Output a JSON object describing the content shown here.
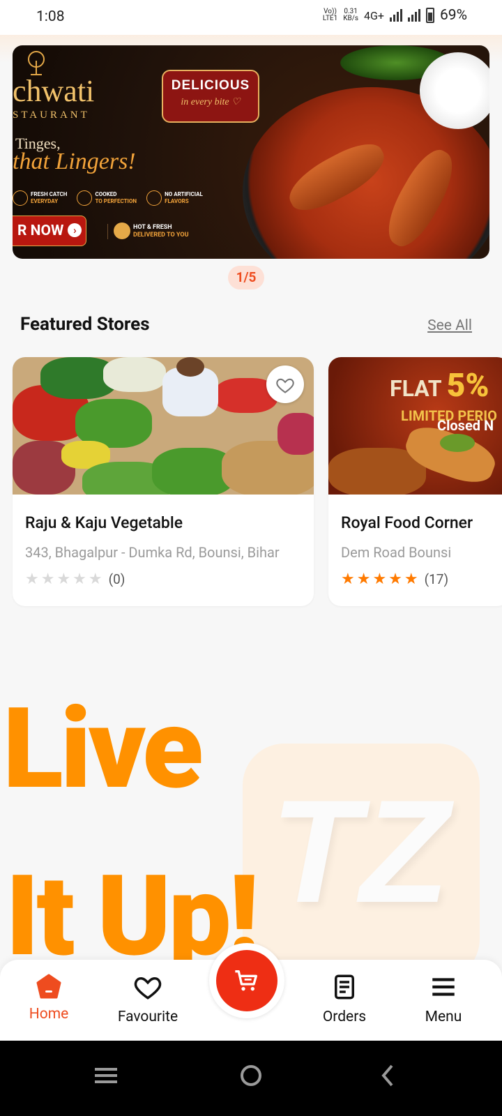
{
  "status_bar": {
    "time": "1:08",
    "volte_top": "Vo))",
    "volte_bottom": "LTE1",
    "speed_top": "0.31",
    "speed_bottom": "KB/s",
    "network": "4G+",
    "battery": "69%"
  },
  "banner": {
    "brand": "chwati",
    "brand_sub": "STAURANT",
    "tagline_1": "Tinges,",
    "tagline_2": "that Lingers!",
    "badge_title": "DELICIOUS",
    "badge_sub": "in every bite ♡",
    "features": [
      {
        "line1": "FRESH CATCH",
        "line2": "EVERYDAY"
      },
      {
        "line1": "COOKED",
        "line2": "TO PERFECTION"
      },
      {
        "line1": "NO ARTIFICIAL",
        "line2": "FLAVORS"
      }
    ],
    "cta": "R NOW",
    "delivery_line1": "HOT & FRESH",
    "delivery_line2": "DELIVERED TO YOU",
    "pager": "1/5"
  },
  "featured": {
    "title": "Featured Stores",
    "see_all": "See All",
    "stores": [
      {
        "name": "Raju & Kaju Vegetable",
        "address": "343, Bhagalpur - Dumka Rd, Bounsi, Bihar",
        "stars": "★★★★★",
        "rating_count": "(0)",
        "rating_value": 0,
        "star_color": "#d9d9d9",
        "status": ""
      },
      {
        "name": "Royal Food Corner",
        "address": "Dem Road Bounsi",
        "stars": "★★★★★",
        "rating_count": "(17)",
        "rating_value": 5,
        "star_color": "#ff7a00",
        "status": "Closed N",
        "promo_flat": "FLAT",
        "promo_pct": "5%",
        "promo_limited": "LIMITED PERIO"
      }
    ]
  },
  "promo": {
    "line1": "Live",
    "line2": "It Up!",
    "logo_text": "TZ"
  },
  "bottom_nav": {
    "home": "Home",
    "favourite": "Favourite",
    "orders": "Orders",
    "menu": "Menu"
  },
  "colors": {
    "accent": "#ee4c1f",
    "orange": "#ff9100",
    "cart": "#ee2e14"
  }
}
